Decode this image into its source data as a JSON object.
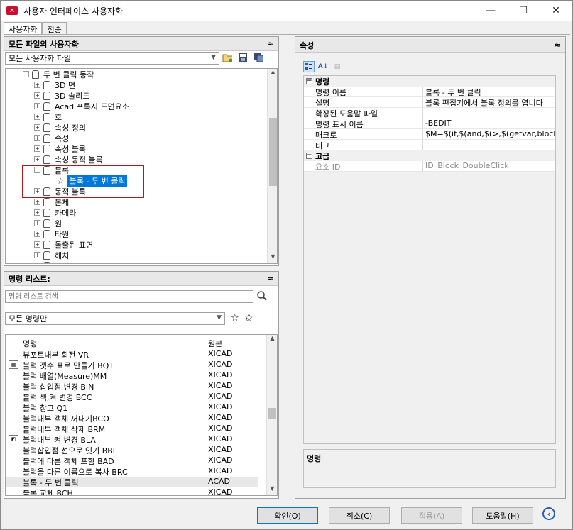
{
  "window": {
    "app_icon_text": "A",
    "title": "사용자 인터페이스 사용자화"
  },
  "tabs": [
    {
      "label": "사용자화"
    },
    {
      "label": "전송"
    }
  ],
  "files_panel": {
    "header": "모든 파일의 사용자화",
    "collapse_glyph": "≈",
    "file_combo": "모든 사용자화 파일"
  },
  "tree": {
    "parent": "두 번 클릭 동작",
    "items": [
      {
        "label": "3D 면"
      },
      {
        "label": "3D 솔리드"
      },
      {
        "label": "Acad 프록시 도면요소"
      },
      {
        "label": "호"
      },
      {
        "label": "속성 정의"
      },
      {
        "label": "속성"
      },
      {
        "label": "속성 블록"
      },
      {
        "label": "속성 동적 블록"
      },
      {
        "label": "블록"
      },
      {
        "label": "블록 - 두 번 클릭"
      },
      {
        "label": "동적 블록"
      },
      {
        "label": "본체"
      },
      {
        "label": "카메라"
      },
      {
        "label": "원"
      },
      {
        "label": "타원"
      },
      {
        "label": "돌출된 표면"
      },
      {
        "label": "해치"
      },
      {
        "label": "나선"
      }
    ]
  },
  "command_panel": {
    "header": "명령 리스트:",
    "search_placeholder": "명령 리스트 검색",
    "filter_combo": "모든 명령만",
    "columns": {
      "name": "명령",
      "source": "원본"
    },
    "rows": [
      {
        "name": "뷰포트내부 회전   VR",
        "source": "XICAD"
      },
      {
        "name": "블럭 갯수 표로 만들기   BQT",
        "source": "XICAD"
      },
      {
        "name": "블럭 배열(Measure)MM",
        "source": "XICAD"
      },
      {
        "name": "블럭 삽입점 변경   BIN",
        "source": "XICAD"
      },
      {
        "name": "블럭 색,켜 변경   BCC",
        "source": "XICAD"
      },
      {
        "name": "블럭 창고   Q1",
        "source": "XICAD"
      },
      {
        "name": "블럭내부 객체 꺼내기BCO",
        "source": "XICAD"
      },
      {
        "name": "블럭내부 객체 삭제   BRM",
        "source": "XICAD"
      },
      {
        "name": "블럭내부 켜 변경   BLA",
        "source": "XICAD"
      },
      {
        "name": "블럭삽입점 선으로 잇기  BBL",
        "source": "XICAD"
      },
      {
        "name": "블럭에 다른 객체 포함   BAD",
        "source": "XICAD"
      },
      {
        "name": "블럭을 다른 이름으로 복사  BRC",
        "source": "XICAD"
      },
      {
        "name": "블록 - 두 번 클릭",
        "source": "ACAD"
      },
      {
        "name": "블록 교체 BCH",
        "source": "XICAD"
      }
    ]
  },
  "properties": {
    "header": "속성",
    "categories": [
      {
        "name": "명령",
        "rows": [
          {
            "key": "명령 이름",
            "value": "블록 - 두 번 클릭"
          },
          {
            "key": "설명",
            "value": "블록 편집기에서 블록 정의를 엽니다"
          },
          {
            "key": "확장된 도움말 파일",
            "value": ""
          },
          {
            "key": "명령 표시 이름",
            "value": "-BEDIT"
          },
          {
            "key": "매크로",
            "value": "$M=$(if,$(and,$(>,$(getvar,blockeditlo"
          },
          {
            "key": "태그",
            "value": ""
          }
        ]
      },
      {
        "name": "고급",
        "rows": [
          {
            "key": "요소 ID",
            "value": "ID_Block_DoubleClick"
          }
        ]
      }
    ],
    "description_title": "명령"
  },
  "buttons": {
    "ok": "확인(O)",
    "cancel": "취소(C)",
    "apply": "적용(A)",
    "help": "도움말(H)"
  }
}
